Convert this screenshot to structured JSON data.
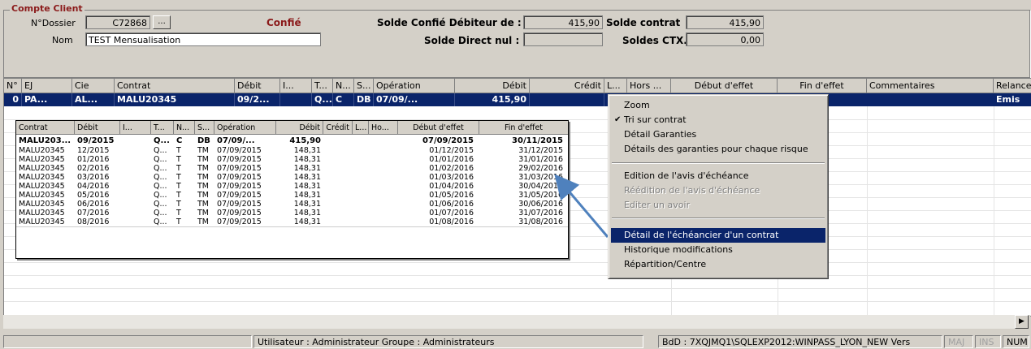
{
  "group": {
    "title": "Compte Client",
    "dossier_label": "N°Dossier",
    "dossier_value": "C72868",
    "browse_label": "...",
    "confie_label": "Confié",
    "nom_label": "Nom",
    "nom_value": "TEST Mensualisation",
    "solde_confie_label": "Solde Confié Débiteur de :",
    "solde_confie_value": "415,90",
    "solde_contrat_label": "Solde contrat",
    "solde_contrat_value": "415,90",
    "solde_direct_label": "Solde Direct nul :",
    "solde_direct_value": "",
    "soldes_ctx_label": "Soldes CTX.",
    "soldes_ctx_value": "0,00"
  },
  "grid": {
    "headers": [
      "N°",
      "EJ",
      "Cie",
      "Contrat",
      "Débit",
      "I...",
      "T...",
      "N...",
      "S...",
      "Opération",
      "Débit",
      "Crédit",
      "L...",
      "Hors ...",
      "Début d'effet",
      "Fin d'effet",
      "Commentaires",
      "Relance"
    ],
    "selected_row": [
      "0",
      "PA...",
      "AL...",
      "MALU20345",
      "09/2...",
      "",
      "Q...",
      "C",
      "DB",
      "07/09/...",
      "415,90",
      "",
      "",
      "",
      "07/09/2015",
      "30/11/2015",
      "",
      "Emis"
    ]
  },
  "popup": {
    "headers": [
      "Contrat",
      "Débit",
      "I...",
      "T...",
      "N...",
      "S...",
      "Opération",
      "Débit",
      "Crédit",
      "L...",
      "Ho...",
      "Début d'effet",
      "Fin d'effet"
    ],
    "rows": [
      [
        "MALU203...",
        "09/2015",
        "",
        "Q...",
        "C",
        "DB",
        "07/09/...",
        "415,90",
        "",
        "",
        "",
        "07/09/2015",
        "30/11/2015"
      ],
      [
        "MALU20345",
        "12/2015",
        "",
        "Q...",
        "T",
        "TM",
        "07/09/2015",
        "148,31",
        "",
        "",
        "",
        "01/12/2015",
        "31/12/2015"
      ],
      [
        "MALU20345",
        "01/2016",
        "",
        "Q...",
        "T",
        "TM",
        "07/09/2015",
        "148,31",
        "",
        "",
        "",
        "01/01/2016",
        "31/01/2016"
      ],
      [
        "MALU20345",
        "02/2016",
        "",
        "Q...",
        "T",
        "TM",
        "07/09/2015",
        "148,31",
        "",
        "",
        "",
        "01/02/2016",
        "29/02/2016"
      ],
      [
        "MALU20345",
        "03/2016",
        "",
        "Q...",
        "T",
        "TM",
        "07/09/2015",
        "148,31",
        "",
        "",
        "",
        "01/03/2016",
        "31/03/2016"
      ],
      [
        "MALU20345",
        "04/2016",
        "",
        "Q...",
        "T",
        "TM",
        "07/09/2015",
        "148,31",
        "",
        "",
        "",
        "01/04/2016",
        "30/04/2016"
      ],
      [
        "MALU20345",
        "05/2016",
        "",
        "Q...",
        "T",
        "TM",
        "07/09/2015",
        "148,31",
        "",
        "",
        "",
        "01/05/2016",
        "31/05/2016"
      ],
      [
        "MALU20345",
        "06/2016",
        "",
        "Q...",
        "T",
        "TM",
        "07/09/2015",
        "148,31",
        "",
        "",
        "",
        "01/06/2016",
        "30/06/2016"
      ],
      [
        "MALU20345",
        "07/2016",
        "",
        "Q...",
        "T",
        "TM",
        "07/09/2015",
        "148,31",
        "",
        "",
        "",
        "01/07/2016",
        "31/07/2016"
      ],
      [
        "MALU20345",
        "08/2016",
        "",
        "Q...",
        "T",
        "TM",
        "07/09/2015",
        "148,31",
        "",
        "",
        "",
        "01/08/2016",
        "31/08/2016"
      ]
    ]
  },
  "menu": {
    "items": [
      {
        "label": "Zoom"
      },
      {
        "label": "Tri sur contrat",
        "checked": true
      },
      {
        "label": "Détail Garanties"
      },
      {
        "label": "Détails des garanties pour chaque risque"
      },
      {
        "label": "Edition de l'avis d'échéance"
      },
      {
        "label": "Réédition de l'avis d'échéance",
        "disabled": true
      },
      {
        "label": "Editer un avoir",
        "disabled": true
      },
      {
        "label": "Détail de l'échéancier d'un contrat",
        "highlighted": true
      },
      {
        "label": "Historique modifications"
      },
      {
        "label": "Répartition/Centre"
      }
    ]
  },
  "status": {
    "user": "Utilisateur : Administrateur  Groupe : Administrateurs",
    "db": "BdD : 7XQJMQ1\\SQLEXP2012:WINPASS_LYON_NEW Vers",
    "maj": "MAJ",
    "ins": "INS",
    "num": "NUM"
  },
  "colors": {
    "selection": "#0a246a",
    "window_bg": "#d4d0c8",
    "group_title": "#8b1a1a",
    "arrow": "#4f81bd"
  }
}
